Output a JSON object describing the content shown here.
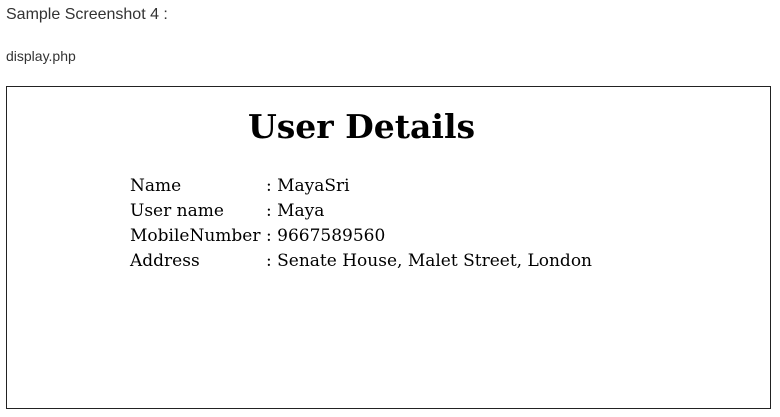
{
  "caption": "Sample Screenshot 4 :",
  "filename": "display.php",
  "page": {
    "title": "User Details",
    "rows": [
      {
        "label": "Name",
        "value": ": MayaSri"
      },
      {
        "label": "User name",
        "value": ": Maya"
      },
      {
        "label": "MobileNumber",
        "value": ": 9667589560"
      },
      {
        "label": "Address",
        "value": ": Senate House, Malet Street, London"
      }
    ]
  }
}
